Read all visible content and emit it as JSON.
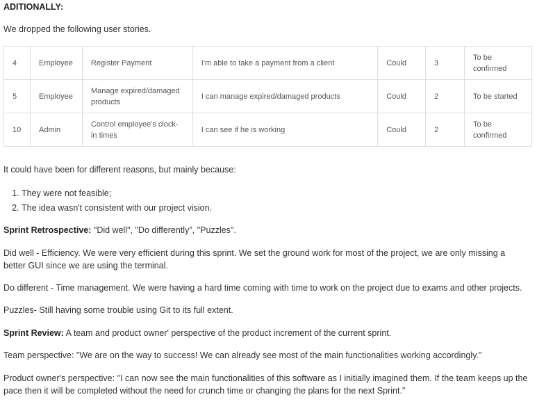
{
  "heading": "ADITIONALLY:",
  "intro": "We dropped the following user stories.",
  "dropped_stories": [
    {
      "id": "4",
      "role": "Employee",
      "title": "Register Payment",
      "story": "I'm able to take a payment from a client",
      "priority": "Could",
      "points": "3",
      "status": "To be confirmed"
    },
    {
      "id": "5",
      "role": "Employee",
      "title": "Manage expired/damaged products",
      "story": "I can manage expired/damaged products",
      "priority": "Could",
      "points": "2",
      "status": "To be started"
    },
    {
      "id": "10",
      "role": "Admin",
      "title": "Control employee's clock-in times",
      "story": "I can see if he is working",
      "priority": "Could",
      "points": "2",
      "status": "To be confirmed"
    }
  ],
  "reasons_intro": "It could have been for different reasons, but mainly because:",
  "reasons": [
    "They were not feasible;",
    "The idea wasn't consistent with our project vision."
  ],
  "retrospective": {
    "label": "Sprint Retrospective:",
    "text": " \"Did well\", \"Do differently\", \"Puzzles\".",
    "did_well_1": "Did well - Efficiency. We were very efficient during this sprint. We set the ground work for most of the project, we are only missing a",
    "did_well_2": "better GUI since we are using the terminal.",
    "do_different": "Do different - Time management. We were having a hard time coming with time to work on the project due to exams and other projects.",
    "puzzles": "Puzzles- Still having some trouble using Git to its full extent."
  },
  "review": {
    "label": "Sprint Review:",
    "text": " A team and product owner' perspective of the product increment of the current sprint.",
    "team": "Team perspective: \"We are on the way to success! We can already see most of the main functionalities working accordingly.\"",
    "owner_1": "Product owner's perspective: \"I can now see the main functionalities of this software as I initially imagined them. If the team keeps up the",
    "owner_2": "pace then it will be completed without the need for crunch time or changing the plans for the next Sprint.\""
  }
}
